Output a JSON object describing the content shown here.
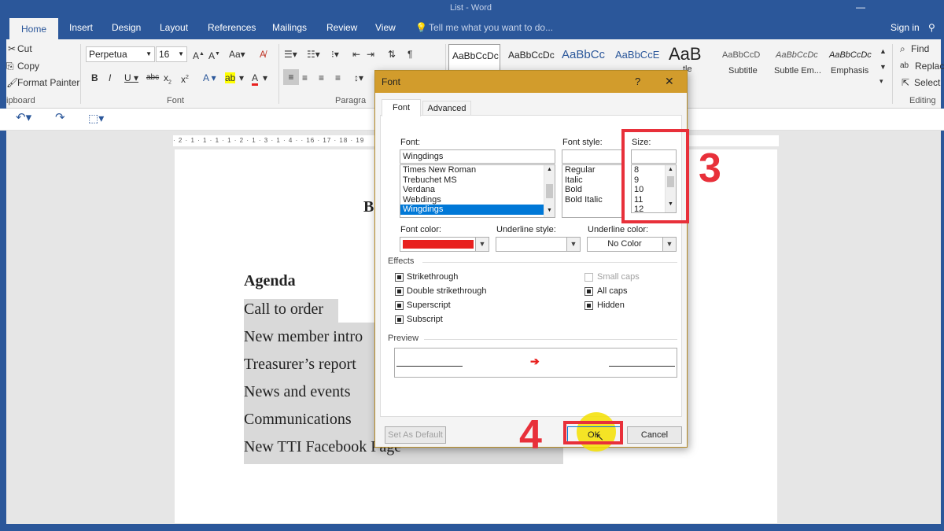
{
  "window": {
    "title": "List - Word"
  },
  "tabs": [
    {
      "label": "Home"
    },
    {
      "label": "Insert"
    },
    {
      "label": "Design"
    },
    {
      "label": "Layout"
    },
    {
      "label": "References"
    },
    {
      "label": "Mailings"
    },
    {
      "label": "Review"
    },
    {
      "label": "View"
    }
  ],
  "tell_me": "Tell me what you want to do...",
  "sign_in": "Sign in",
  "clipboard": {
    "cut": "Cut",
    "copy": "Copy",
    "format_painter": "Format Painter",
    "group_label": "ipboard"
  },
  "font_group": {
    "font_name": "Perpetua",
    "font_size": "16",
    "group_label": "Font"
  },
  "paragraph_group": {
    "group_label": "Paragra"
  },
  "styles": [
    {
      "preview": "AaBbCcDc",
      "name": ""
    },
    {
      "preview": "AaBbCcDc",
      "name": ""
    },
    {
      "preview": "AaBbCc",
      "name": ""
    },
    {
      "preview": "AaBbCcE",
      "name": ""
    },
    {
      "preview": "AaB",
      "name": "tle"
    },
    {
      "preview": "AaBbCcD",
      "name": "Subtitle"
    },
    {
      "preview": "AaBbCcDc",
      "name": "Subtle Em..."
    },
    {
      "preview": "AaBbCcDc",
      "name": "Emphasis"
    }
  ],
  "editing": {
    "find": "Find",
    "replace": "Replac",
    "select": "Select",
    "group_label": "Editing"
  },
  "ruler_text": "· 2 · 1 · 1 · 1 · 1 · 2 · 1 · 3 · 1 · 4 ·   · 16 · 17 · 18 · 19",
  "document": {
    "partial_title": "B",
    "heading": "Agenda",
    "lines": [
      "Call to order",
      "New member intro",
      "Treasurer’s report",
      "News and events",
      "Communications",
      "New TTI Facebook Page"
    ]
  },
  "dialog": {
    "title": "Font",
    "help": "?",
    "close": "✕",
    "tabs": {
      "font": "Font",
      "advanced": "Advanced"
    },
    "font_label": "Font:",
    "font_value": "Wingdings",
    "font_list": [
      "Times New Roman",
      "Trebuchet MS",
      "Verdana",
      "Webdings",
      "Wingdings"
    ],
    "style_label": "Font style:",
    "style_value": "",
    "style_list": [
      "Regular",
      "Italic",
      "Bold",
      "Bold Italic"
    ],
    "size_label": "Size:",
    "size_value": "",
    "size_list": [
      "8",
      "9",
      "10",
      "11",
      "12"
    ],
    "font_color_label": "Font color:",
    "font_color": "#e8201e",
    "underline_style_label": "Underline style:",
    "underline_color_label": "Underline color:",
    "underline_color_value": "No Color",
    "effects_label": "Effects",
    "effects": {
      "strikethrough": "Strikethrough",
      "double_strikethrough": "Double strikethrough",
      "superscript": "Superscript",
      "subscript": "Subscript",
      "small_caps": "Small caps",
      "all_caps": "All caps",
      "hidden": "Hidden"
    },
    "preview_label": "Preview",
    "preview_glyph": "➔",
    "set_default": "Set As Default",
    "ok": "OK",
    "cancel": "Cancel"
  },
  "annotations": {
    "step3": "3",
    "step4": "4"
  },
  "colors": {
    "word_blue": "#2b579a",
    "dialog_title": "#d29c2c",
    "annotation_red": "#e8303a",
    "selection": "#0078d7",
    "cursor_highlight": "#f5e000"
  }
}
